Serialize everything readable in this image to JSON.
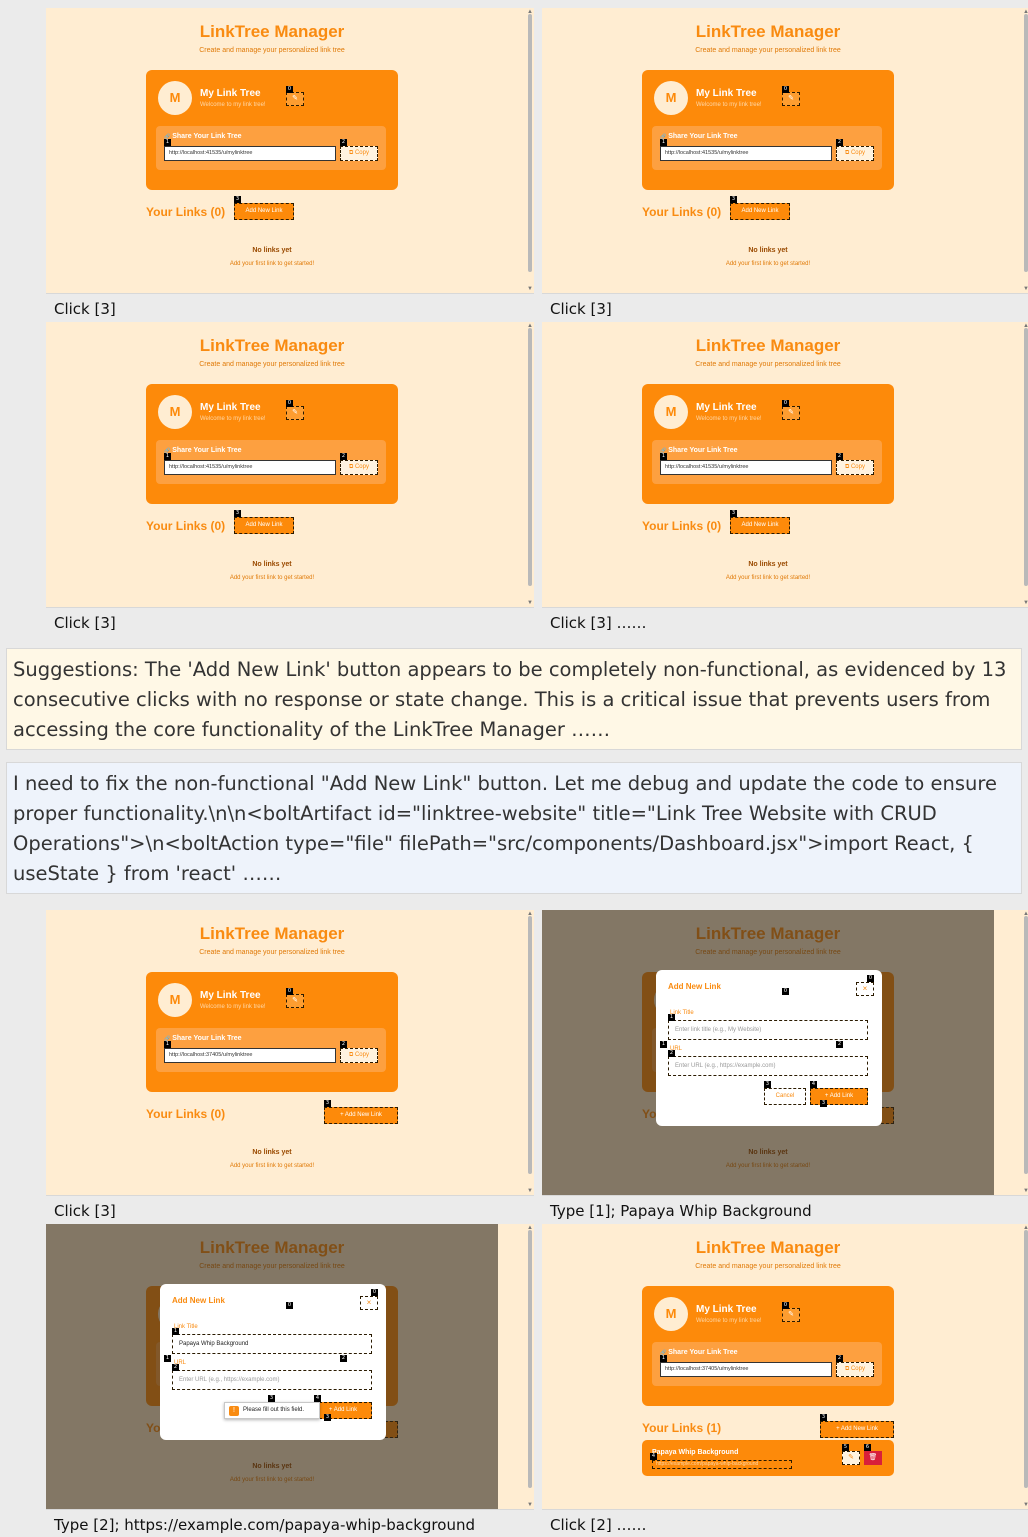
{
  "app": {
    "title": "LinkTree Manager",
    "subtitle": "Create and manage your personalized link tree",
    "avatar_initial": "M",
    "profile_name": "My Link Tree",
    "profile_welcome": "Welcome to my link tree!",
    "share_title": "Share Your Link Tree",
    "copy_label": "Copy",
    "your_links_0": "Your Links (0)",
    "your_links_1": "Your Links (1)",
    "add_new_link_label": "Add New Link",
    "add_new_link_plus_label": "+ Add New Link",
    "no_links": "No links yet",
    "no_links_hint": "Add your first link to get started!",
    "edit_icon": "✎",
    "copy_icon": "⧉",
    "share_icon": "🔗",
    "delete_icon": "🗑",
    "close_icon": "×"
  },
  "urls": {
    "old": "http://localhost:41535/u/mylinktree",
    "new": "http://localhost:37405/u/mylinktree"
  },
  "modal": {
    "title": "Add New Link",
    "title_label": "Link Title",
    "title_placeholder": "Enter link title (e.g., My Website)",
    "url_label": "URL",
    "url_placeholder": "Enter URL (e.g., https://example.com)",
    "cancel_label": "Cancel",
    "add_label": "+ Add Link",
    "typed_title": "Papaya Whip Background",
    "validation_msg": "Please fill out this field."
  },
  "link_item": {
    "title": "Papaya Whip Background",
    "url": "https://example.com/papaya-whip-background"
  },
  "captions": [
    "Click [3]",
    "Click [3]",
    "Click [3]",
    "Click [3] ……",
    "Click [3]",
    "Type [1]; Papaya Whip Background",
    "Type [2]; https://example.com/papaya-whip-background",
    "Click [2] ……"
  ],
  "suggestion_text": "Suggestions: The 'Add New Link' button appears to be completely non-functional, as evidenced by 13 consecutive clicks with no response or state change. This is a critical issue that prevents users from accessing the core functionality of the LinkTree Manager ……",
  "code_text": "I need to fix the non-functional \"Add New Link\" button. Let me debug and update the code to ensure proper functionality.\\n\\n<boltArtifact id=\"linktree-website\" title=\"Link Tree Website with CRUD Operations\">\\n<boltAction type=\"file\" filePath=\"src/components/Dashboard.jsx\">import React, { useState } from 'react' ……",
  "colors": {
    "page_bg": "#ffedd2",
    "accent": "#fd8a0a",
    "title": "#f98b11",
    "danger": "#d81f3a"
  }
}
